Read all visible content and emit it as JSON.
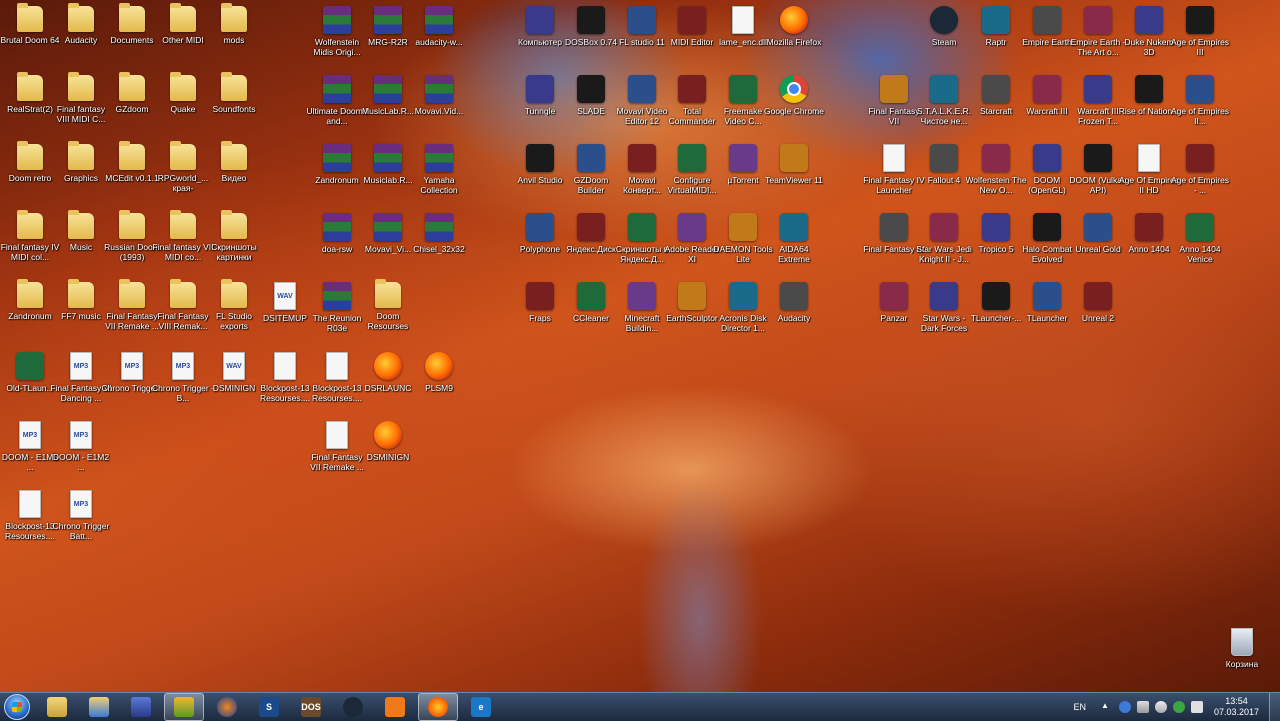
{
  "desktop": {
    "icons": [
      {
        "label": "Brutal Doom 64",
        "type": "folder"
      },
      {
        "label": "Audacity",
        "type": "folder"
      },
      {
        "label": "Documents",
        "type": "folder"
      },
      {
        "label": "Other MIDI",
        "type": "folder"
      },
      {
        "label": "mods",
        "type": "folder"
      },
      {
        "label": "Wolfenstein Midis Origi...",
        "type": "rar"
      },
      {
        "label": "MRG-R2R",
        "type": "rar"
      },
      {
        "label": "audacity-w...",
        "type": "rar"
      },
      {
        "label": "Компьютер",
        "type": "app"
      },
      {
        "label": "DOSBox 0.74",
        "type": "app"
      },
      {
        "label": "FL studio 11",
        "type": "app"
      },
      {
        "label": "MIDI Editor",
        "type": "app"
      },
      {
        "label": "lame_enc.dll",
        "type": "doc"
      },
      {
        "label": "Mozilla Firefox",
        "type": "firefox"
      },
      {
        "label": "Steam",
        "type": "steam"
      },
      {
        "label": "Raptr",
        "type": "app"
      },
      {
        "label": "Empire Earth",
        "type": "app"
      },
      {
        "label": "Empire Earth - The Art o...",
        "type": "app"
      },
      {
        "label": "Duke Nukem 3D",
        "type": "app"
      },
      {
        "label": "Age of Empires III",
        "type": "app"
      },
      {
        "label": "RealStrat(2)",
        "type": "folder"
      },
      {
        "label": "Final fantasy VIII MIDI C...",
        "type": "folder"
      },
      {
        "label": "GZdoom",
        "type": "folder"
      },
      {
        "label": "Quake",
        "type": "folder"
      },
      {
        "label": "Soundfonts",
        "type": "folder"
      },
      {
        "label": "Ultimate Doom I and...",
        "type": "rar"
      },
      {
        "label": "MusicLab.R...",
        "type": "rar"
      },
      {
        "label": "Movavi.Vid...",
        "type": "rar"
      },
      {
        "label": "Tunngle",
        "type": "app"
      },
      {
        "label": "SLADE",
        "type": "app"
      },
      {
        "label": "Movavi Video Editor 12",
        "type": "app"
      },
      {
        "label": "Total Commander",
        "type": "app"
      },
      {
        "label": "Freemake Video C...",
        "type": "app"
      },
      {
        "label": "Google Chrome",
        "type": "chrome"
      },
      {
        "label": "Final Fantasy VII",
        "type": "app"
      },
      {
        "label": "S.T.A.L.K.E.R. Чистое не...",
        "type": "app"
      },
      {
        "label": "Starcraft",
        "type": "app"
      },
      {
        "label": "Warcraft III",
        "type": "app"
      },
      {
        "label": "Warcraft III Frozen T...",
        "type": "app"
      },
      {
        "label": "Rise of Nation...",
        "type": "app"
      },
      {
        "label": "Age of Empires II...",
        "type": "app"
      },
      {
        "label": "Doom retro",
        "type": "folder"
      },
      {
        "label": "Graphics",
        "type": "folder"
      },
      {
        "label": "MCEdit v0.1.1",
        "type": "folder"
      },
      {
        "label": "RPGworld_... края-",
        "type": "folder"
      },
      {
        "label": "Видео",
        "type": "folder"
      },
      {
        "label": "Zandronum",
        "type": "rar"
      },
      {
        "label": "Musiclab.R...",
        "type": "rar"
      },
      {
        "label": "Yamaha Collection",
        "type": "rar"
      },
      {
        "label": "Anvil Studio",
        "type": "app"
      },
      {
        "label": "GZDoom Builder",
        "type": "app"
      },
      {
        "label": "Movavi Конверт...",
        "type": "app"
      },
      {
        "label": "Configure VirtualMIDI...",
        "type": "app"
      },
      {
        "label": "µTorrent",
        "type": "app"
      },
      {
        "label": "TeamViewer 11",
        "type": "app"
      },
      {
        "label": "Final Fantasy IV Launcher",
        "type": "doc"
      },
      {
        "label": "Fallout 4",
        "type": "app"
      },
      {
        "label": "Wolfenstein The New O...",
        "type": "app"
      },
      {
        "label": "DOOM (OpenGL)",
        "type": "app"
      },
      {
        "label": "DOOM (Vulkan API)",
        "type": "app"
      },
      {
        "label": "Age Of Empires II HD",
        "type": "doc"
      },
      {
        "label": "Age of Empires - ...",
        "type": "app"
      },
      {
        "label": "Final fantasy IV MIDI col...",
        "type": "folder"
      },
      {
        "label": "Music",
        "type": "folder"
      },
      {
        "label": "Russian Doom (1993)",
        "type": "folder"
      },
      {
        "label": "Final fantasy VII MIDI co...",
        "type": "folder"
      },
      {
        "label": "Скриншоты картинки",
        "type": "folder"
      },
      {
        "label": "doa-rsw",
        "type": "rar"
      },
      {
        "label": "Movavi_Vi...",
        "type": "rar"
      },
      {
        "label": "Chisel_32x32",
        "type": "rar"
      },
      {
        "label": "Polyphone",
        "type": "app"
      },
      {
        "label": "Яндекс.Диск",
        "type": "app"
      },
      {
        "label": "Скриншоты в Яндекс.Д...",
        "type": "app"
      },
      {
        "label": "Adobe Reader XI",
        "type": "app"
      },
      {
        "label": "DAEMON Tools Lite",
        "type": "app"
      },
      {
        "label": "AIDA64 Extreme",
        "type": "app"
      },
      {
        "label": "Final Fantasy IV",
        "type": "app"
      },
      {
        "label": "Star Wars Jedi Knight II - J...",
        "type": "app"
      },
      {
        "label": "Tropico 5",
        "type": "app"
      },
      {
        "label": "Halo Combat Evolved",
        "type": "app"
      },
      {
        "label": "Unreal Gold",
        "type": "app"
      },
      {
        "label": "Anno 1404",
        "type": "app"
      },
      {
        "label": "Anno 1404 Venice",
        "type": "app"
      },
      {
        "label": "Zandronum",
        "type": "folder"
      },
      {
        "label": "FF7 music",
        "type": "folder"
      },
      {
        "label": "Final Fantasy VII Remake ...",
        "type": "folder"
      },
      {
        "label": "Final Fantasy VIII Remak...",
        "type": "folder"
      },
      {
        "label": "FL Studio exports",
        "type": "folder"
      },
      {
        "label": "DSITEMUP",
        "type": "doc-wav"
      },
      {
        "label": "The Reunion R03e",
        "type": "rar"
      },
      {
        "label": "Doom Resourses",
        "type": "folder"
      },
      {
        "label": "Fraps",
        "type": "app"
      },
      {
        "label": "CCleaner",
        "type": "app"
      },
      {
        "label": "Minecraft Buildin...",
        "type": "app"
      },
      {
        "label": "EarthSculptor",
        "type": "app"
      },
      {
        "label": "Acronis Disk Director 1...",
        "type": "app"
      },
      {
        "label": "Audacity",
        "type": "app"
      },
      {
        "label": "Panzar",
        "type": "app"
      },
      {
        "label": "Star Wars - Dark Forces",
        "type": "app"
      },
      {
        "label": "TLauncher-...",
        "type": "app"
      },
      {
        "label": "TLauncher",
        "type": "app"
      },
      {
        "label": "Unreal 2",
        "type": "app"
      },
      {
        "label": "Old-TLaun...",
        "type": "app"
      },
      {
        "label": "Final Fantasy VI Dancing ...",
        "type": "doc-mp3"
      },
      {
        "label": "Chrono Trigge...",
        "type": "doc-mp3"
      },
      {
        "label": "Chrono Trigger - B...",
        "type": "doc-mp3"
      },
      {
        "label": "DSMINIGN",
        "type": "doc-wav"
      },
      {
        "label": "Blockpost-13 Resourses....",
        "type": "doc"
      },
      {
        "label": "Blockpost-13 Resourses....",
        "type": "doc"
      },
      {
        "label": "DSRLAUNC",
        "type": "firefox"
      },
      {
        "label": "PLSM9",
        "type": "firefox"
      },
      {
        "label": "DOOM - E1M5 ...",
        "type": "doc-mp3"
      },
      {
        "label": "DOOM - E1M2 ...",
        "type": "doc-mp3"
      },
      {
        "label": "Final Fantasy VII Remake ...",
        "type": "doc"
      },
      {
        "label": "DSMINIGN",
        "type": "firefox"
      },
      {
        "label": "Blockpost-13 Resourses....",
        "type": "doc"
      },
      {
        "label": "Chrono Trigger Batt...",
        "type": "doc-mp3"
      },
      {
        "label": "Корзина",
        "type": "recycle"
      }
    ]
  },
  "taskbar": {
    "apps": [
      {
        "name": "explorer",
        "glyph": ""
      },
      {
        "name": "libraries",
        "glyph": ""
      },
      {
        "name": "save",
        "glyph": ""
      },
      {
        "name": "fl-studio",
        "glyph": ""
      },
      {
        "name": "audacity",
        "glyph": ""
      },
      {
        "name": "slade",
        "glyph": "S"
      },
      {
        "name": "dosbox",
        "glyph": "DOS"
      },
      {
        "name": "steam",
        "glyph": ""
      },
      {
        "name": "raptr",
        "glyph": ""
      },
      {
        "name": "firefox",
        "glyph": ""
      },
      {
        "name": "edge",
        "glyph": "e"
      }
    ],
    "tray": {
      "language": "EN",
      "time": "13:54",
      "date": "07.03.2017"
    }
  }
}
